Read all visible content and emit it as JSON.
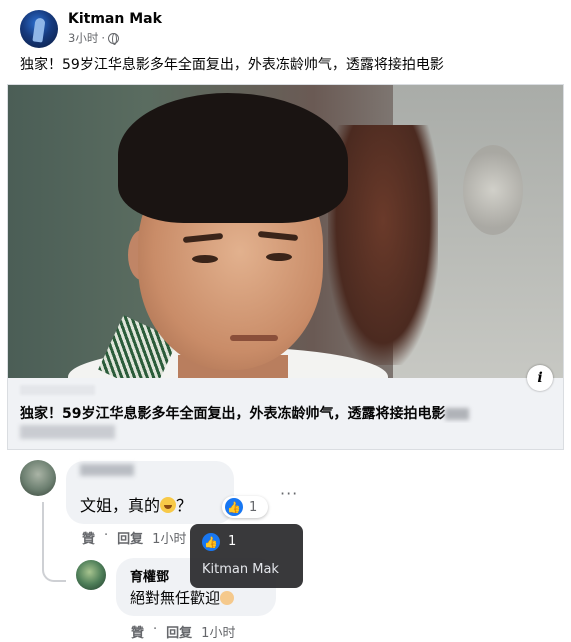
{
  "post": {
    "author": "Kitman Mak",
    "time": "3小时",
    "dot": "·",
    "text": "独家！59岁江华息影多年全面复出，外表冻龄帅气，透露将接拍电影",
    "more_icon": "more-horizontal-icon"
  },
  "link_card": {
    "title": "独家！59岁江华息影多年全面复出，外表冻龄帅气，透露将接拍电影",
    "info_glyph": "i"
  },
  "comments": [
    {
      "text": "文姐，真的",
      "after_emoji": "？",
      "reaction_count": "1",
      "actions": {
        "like": "贊",
        "dot": "·",
        "reply": "回复",
        "time": "1小时"
      }
    },
    {
      "name": "育權鄧",
      "text": "絕對無任歡迎",
      "actions": {
        "like": "贊",
        "dot": "·",
        "reply": "回复",
        "time": "1小时"
      }
    }
  ],
  "tooltip": {
    "count": "1",
    "name": "Kitman Mak"
  },
  "colors": {
    "facebook_blue": "#1877f2",
    "bubble_bg": "#f0f2f5",
    "secondary_text": "#65676b"
  }
}
